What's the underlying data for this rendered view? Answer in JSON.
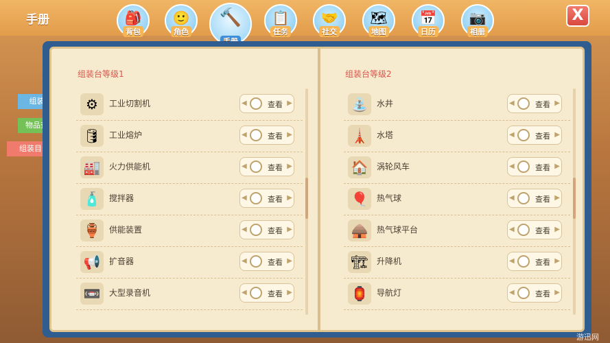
{
  "screen_title": "手册",
  "close_label": "X",
  "nav": [
    {
      "label": "背包",
      "icon": "backpack-icon",
      "glyph": "🎒"
    },
    {
      "label": "角色",
      "icon": "character-icon",
      "glyph": "🙂"
    },
    {
      "label": "手册",
      "icon": "hammer-icon",
      "glyph": "🔨"
    },
    {
      "label": "任务",
      "icon": "task-list-icon",
      "glyph": "📋"
    },
    {
      "label": "社交",
      "icon": "handshake-icon",
      "glyph": "🤝"
    },
    {
      "label": "地图",
      "icon": "map-icon",
      "glyph": "🗺"
    },
    {
      "label": "日历",
      "icon": "calendar-icon",
      "glyph": "📅"
    },
    {
      "label": "相册",
      "icon": "album-icon",
      "glyph": "📷"
    }
  ],
  "side_tabs": [
    {
      "label": "组装书",
      "color": "#6bb6e2"
    },
    {
      "label": "物品查询",
      "color": "#73c157"
    },
    {
      "label": "组装目录",
      "color": "#f07a6c"
    }
  ],
  "left_page": {
    "title": "组装台等级1",
    "items": [
      {
        "name": "工业切割机",
        "icon": "cutter-icon",
        "glyph": "⚙"
      },
      {
        "name": "工业熔炉",
        "icon": "furnace-icon",
        "glyph": "🛢"
      },
      {
        "name": "火力供能机",
        "icon": "generator-icon",
        "glyph": "🏭"
      },
      {
        "name": "搅拌器",
        "icon": "mixer-icon",
        "glyph": "🧴"
      },
      {
        "name": "供能装置",
        "icon": "power-device-icon",
        "glyph": "🏺"
      },
      {
        "name": "扩音器",
        "icon": "amplifier-icon",
        "glyph": "📢"
      },
      {
        "name": "大型录音机",
        "icon": "recorder-icon",
        "glyph": "📼"
      }
    ]
  },
  "right_page": {
    "title": "组装台等级2",
    "items": [
      {
        "name": "水井",
        "icon": "well-icon",
        "glyph": "⛲"
      },
      {
        "name": "水塔",
        "icon": "water-tower-icon",
        "glyph": "🗼"
      },
      {
        "name": "涡轮风车",
        "icon": "windmill-icon",
        "glyph": "🏠"
      },
      {
        "name": "热气球",
        "icon": "balloon-icon",
        "glyph": "🎈"
      },
      {
        "name": "热气球平台",
        "icon": "platform-icon",
        "glyph": "🛖"
      },
      {
        "name": "升降机",
        "icon": "elevator-icon",
        "glyph": "🏗"
      },
      {
        "name": "导航灯",
        "icon": "nav-light-icon",
        "glyph": "🏮"
      }
    ]
  },
  "view_label": "查看",
  "watermark": "游迅网"
}
